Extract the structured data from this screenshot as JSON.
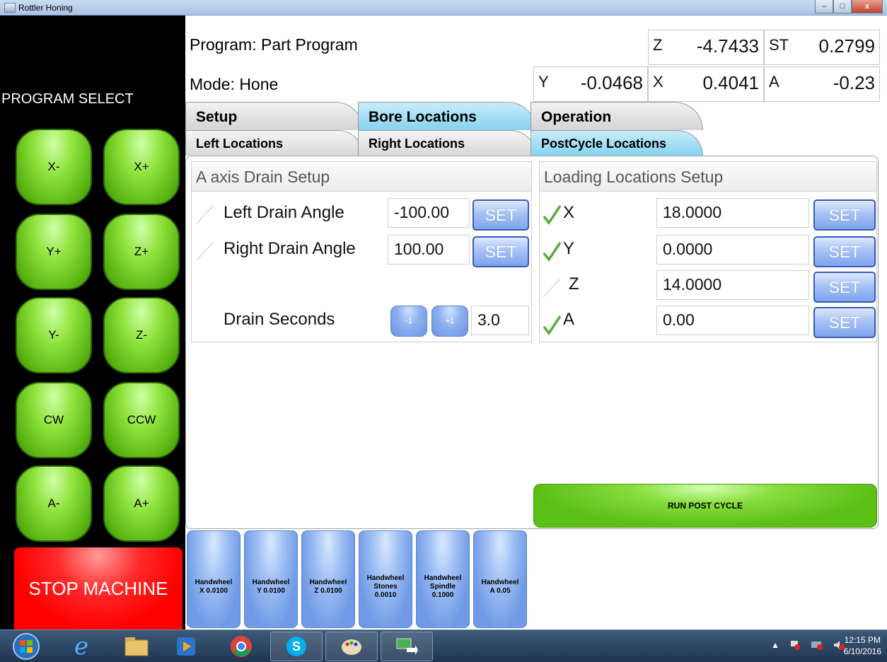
{
  "window": {
    "title": "Rottler Honing",
    "minimize_glyph": "–",
    "maximize_glyph": "□",
    "close_glyph": "x"
  },
  "left": {
    "program_select": "PROGRAM SELECT",
    "jog_buttons": [
      "X-",
      "X+",
      "Y+",
      "Z+",
      "Y-",
      "Z-",
      "CW",
      "CCW",
      "A-",
      "A+"
    ],
    "stop": "STOP MACHINE"
  },
  "header": {
    "program": "Program: Part Program",
    "mode": "Mode: Hone",
    "readouts": {
      "z": {
        "label": "Z",
        "value": "-4.7433"
      },
      "st": {
        "label": "ST",
        "value": "0.2799"
      },
      "y": {
        "label": "Y",
        "value": "-0.0468"
      },
      "x": {
        "label": "X",
        "value": "0.4041"
      },
      "a": {
        "label": "A",
        "value": "-0.23"
      }
    }
  },
  "tabs": [
    "Setup",
    "Bore Locations",
    "Operation"
  ],
  "subtabs": [
    "Left Locations",
    "Right Locations",
    "PostCycle Locations"
  ],
  "drain": {
    "title": "A axis Drain Setup",
    "left_label": "Left Drain Angle",
    "left_value": "-100.00",
    "right_label": "Right Drain Angle",
    "right_value": "100.00",
    "seconds_label": "Drain Seconds",
    "minus": "-1",
    "plus": "+1",
    "seconds_value": "3.0",
    "set": "SET"
  },
  "loading": {
    "title": "Loading Locations Setup",
    "rows": [
      {
        "axis": "X",
        "value": "18.0000",
        "checked": true
      },
      {
        "axis": "Y",
        "value": "0.0000",
        "checked": true
      },
      {
        "axis": "Z",
        "value": "14.0000",
        "checked": false
      },
      {
        "axis": "A",
        "value": "0.00",
        "checked": true
      }
    ],
    "set": "SET"
  },
  "run_post_cycle": "RUN POST CYCLE",
  "handwheels": [
    {
      "line1": "Handwheel",
      "line2": "X 0.0100",
      "line3": ""
    },
    {
      "line1": "Handwheel",
      "line2": "Y 0.0100",
      "line3": ""
    },
    {
      "line1": "Handwheel",
      "line2": "Z 0.0100",
      "line3": ""
    },
    {
      "line1": "Handwheel",
      "line2": "Stones",
      "line3": "0.0010"
    },
    {
      "line1": "Handwheel",
      "line2": "Spindle",
      "line3": "0.1000"
    },
    {
      "line1": "Handwheel",
      "line2": "A 0.05",
      "line3": ""
    }
  ],
  "taskbar": {
    "time": "12:15 PM",
    "date": "6/10/2016",
    "tray_arrow": "▲"
  },
  "colors": {
    "jog_green": "#8fe23c",
    "stop_red": "#ff0000",
    "set_blue": "#7ea4ee",
    "tab_active": "#86d2ef"
  }
}
